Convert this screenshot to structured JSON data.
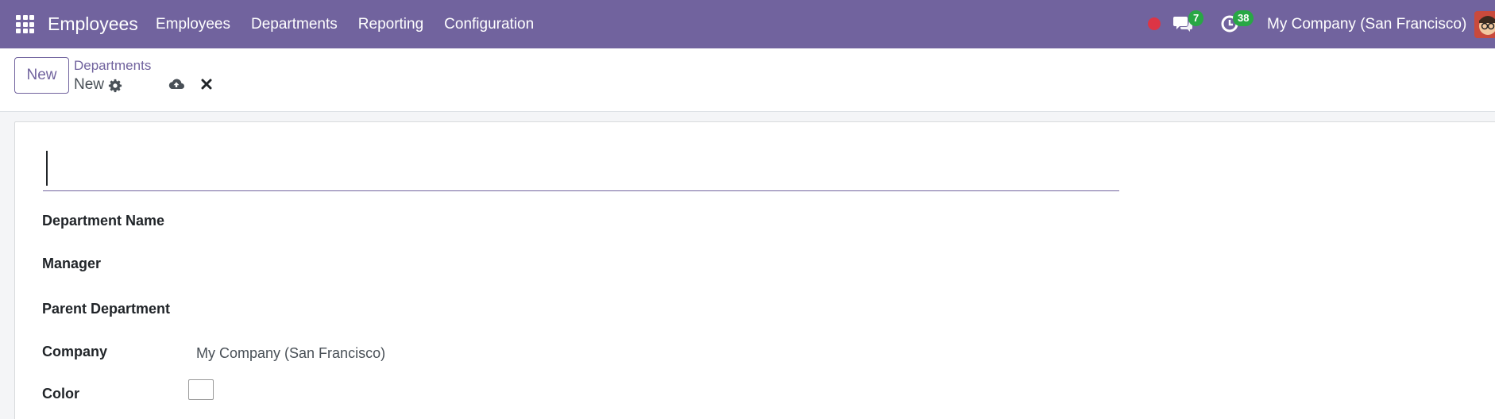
{
  "navbar": {
    "app_title": "Employees",
    "menu": [
      "Employees",
      "Departments",
      "Reporting",
      "Configuration"
    ],
    "chat_count": "7",
    "activity_count": "38",
    "company": "My Company (San Francisco)",
    "color": "#71639e"
  },
  "control_panel": {
    "new_label": "New",
    "breadcrumb_parent": "Departments",
    "breadcrumb_current": "New"
  },
  "form": {
    "title_value": "",
    "fields": {
      "department_name_label": "Department Name",
      "manager_label": "Manager",
      "parent_department_label": "Parent Department",
      "company_label": "Company",
      "company_value": "My Company (San Francisco)",
      "color_label": "Color"
    }
  }
}
